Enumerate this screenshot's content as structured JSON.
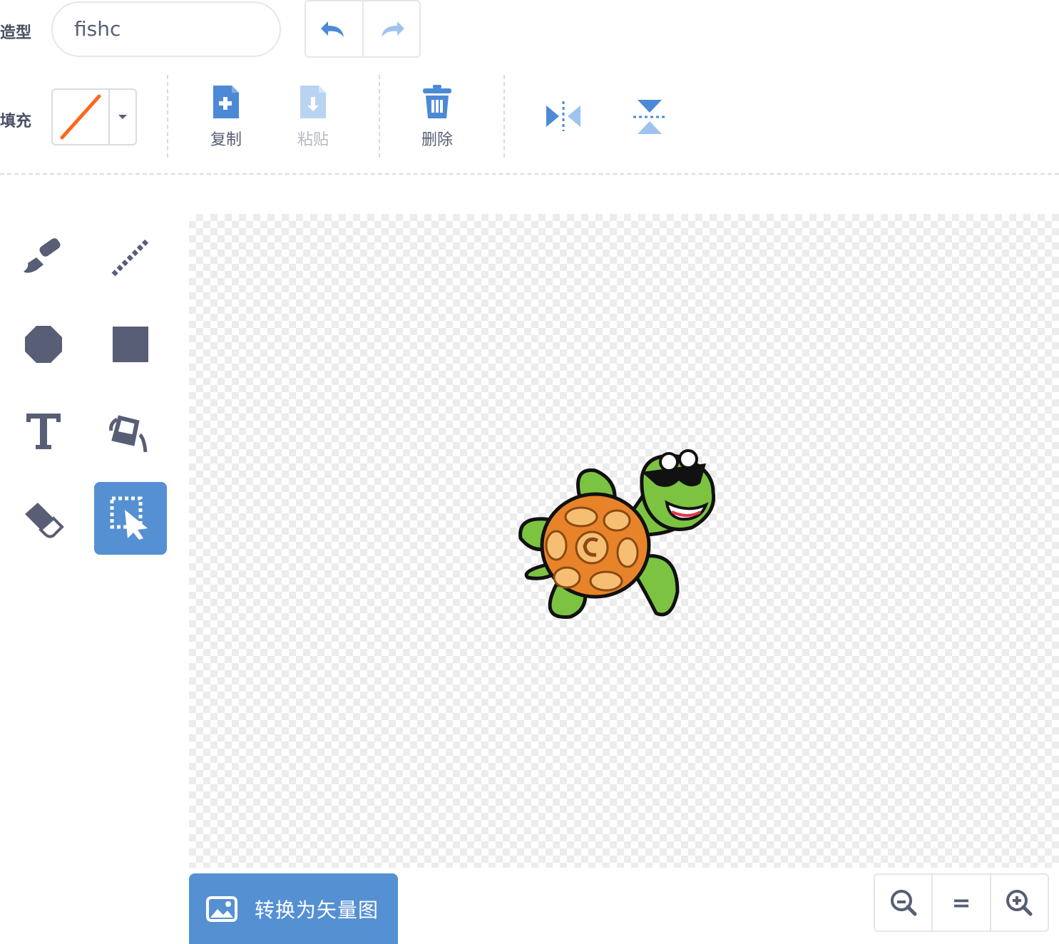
{
  "costume": {
    "label": "造型",
    "name": "fishc"
  },
  "fill": {
    "label": "填充",
    "swatch_color": "#ff661a"
  },
  "actions": {
    "copy": "复制",
    "paste": "粘贴",
    "delete": "删除"
  },
  "tools": [
    "brush",
    "line",
    "circle",
    "rectangle",
    "text",
    "fill",
    "eraser",
    "select"
  ],
  "active_tool": "select",
  "convert_button": "转换为矢量图",
  "zoom": {
    "out": "zoom-out",
    "reset": "=",
    "in": "zoom-in"
  },
  "colors": {
    "accent": "#5590d3",
    "icon": "#575e75",
    "turtle_green": "#7cc341",
    "shell_orange": "#e8832a"
  }
}
